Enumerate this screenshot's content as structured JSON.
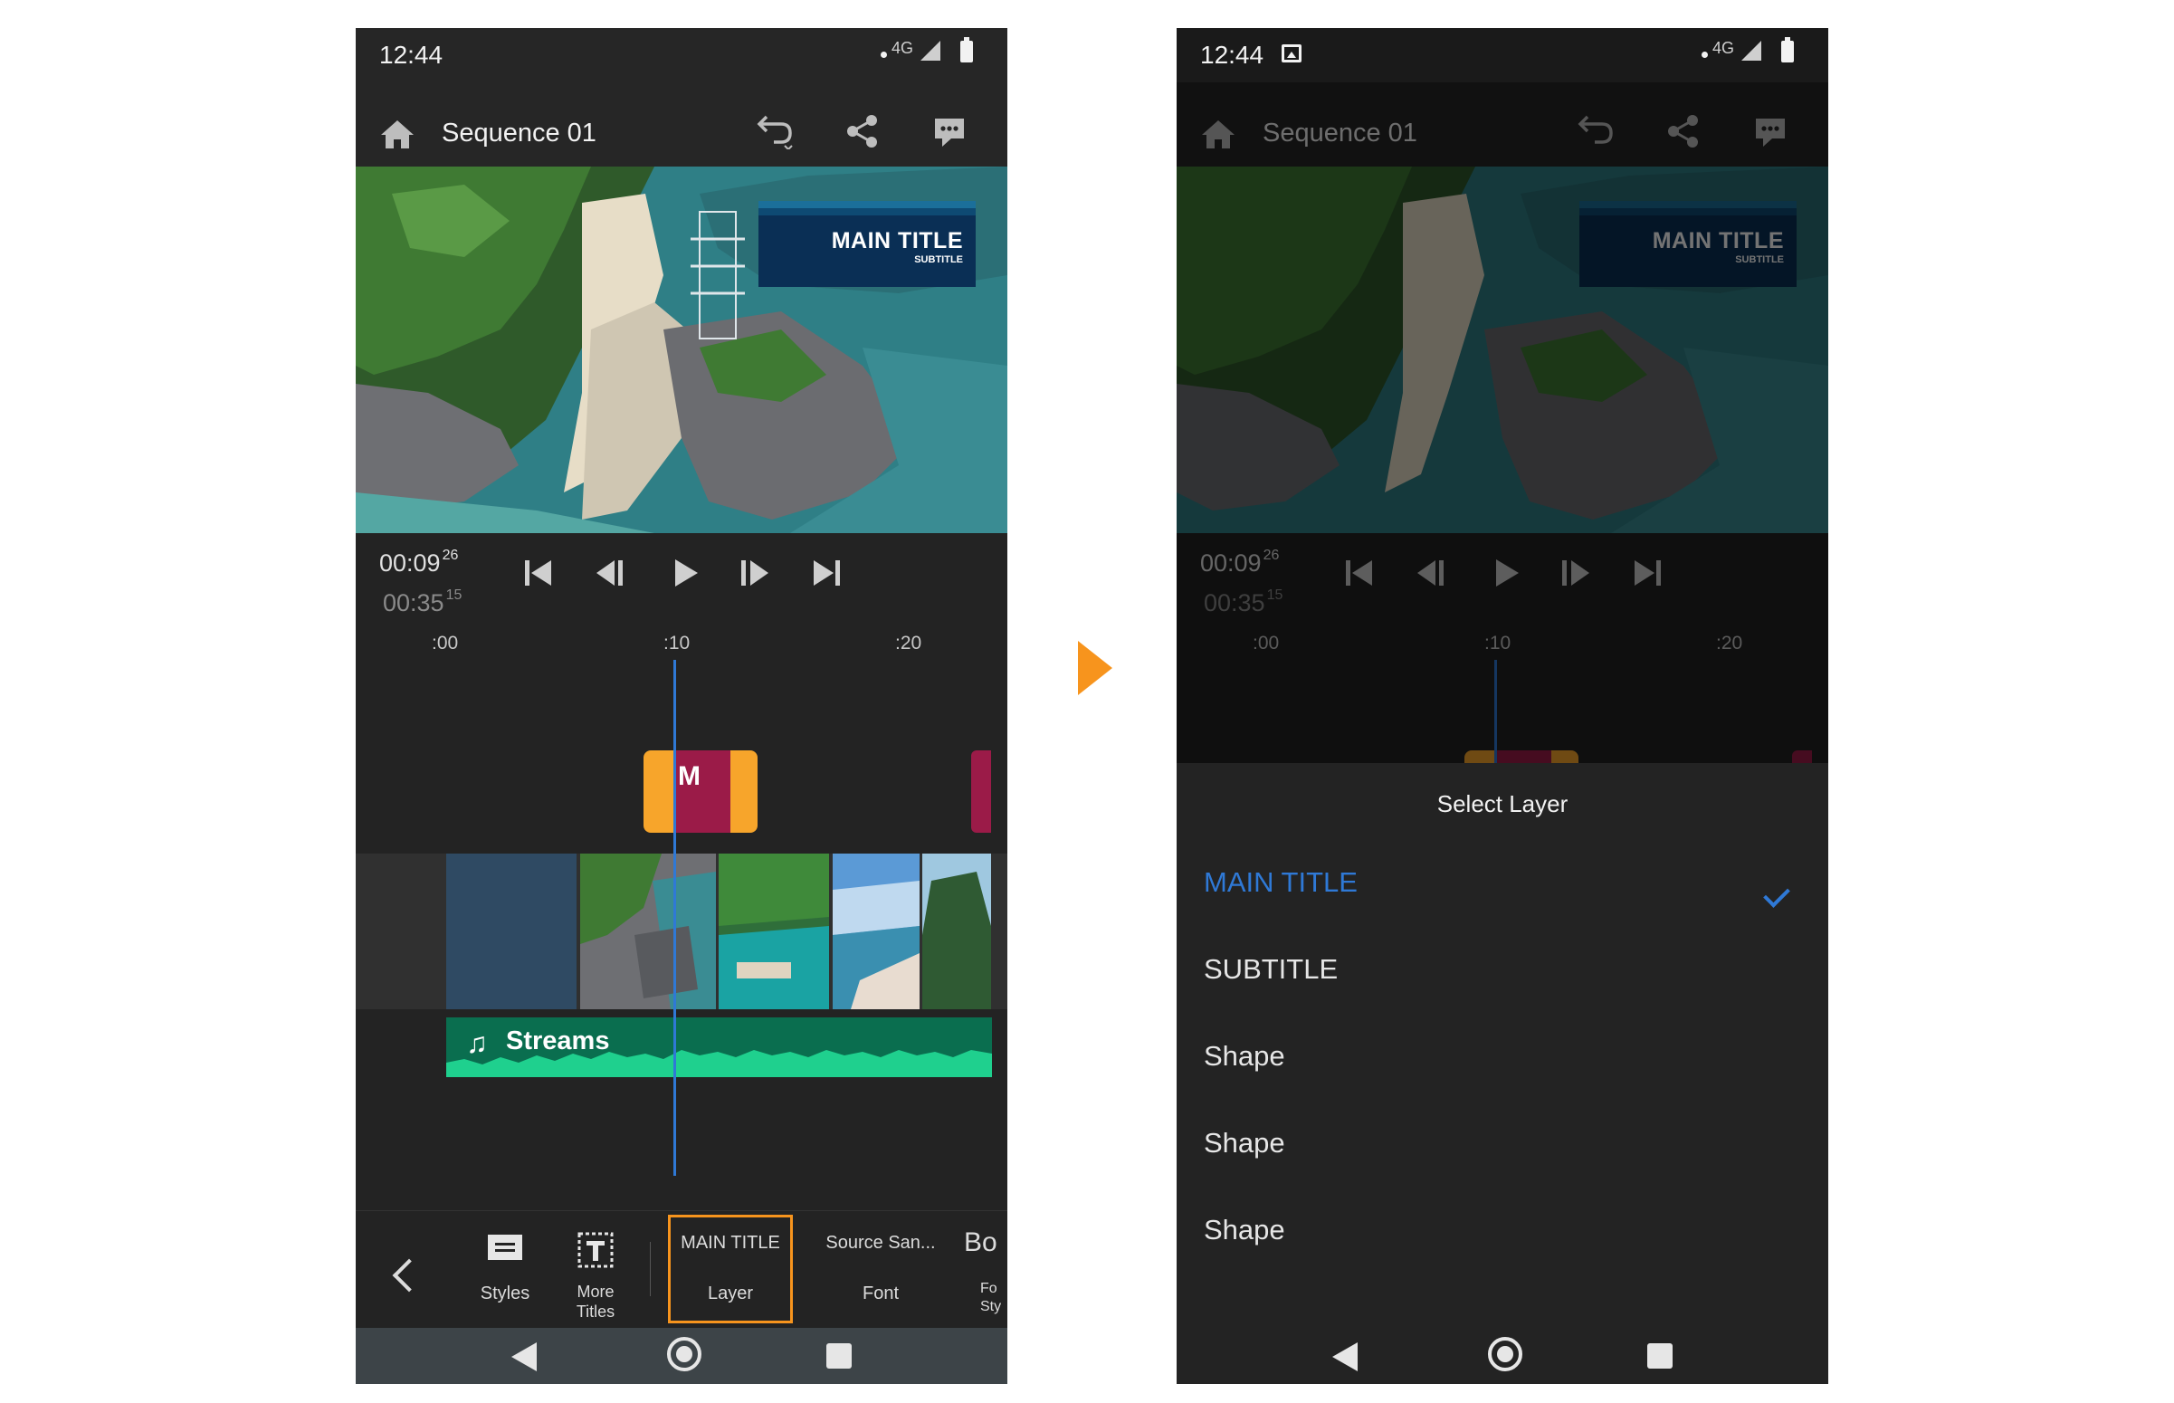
{
  "status": {
    "time": "12:44",
    "network": "4G"
  },
  "appbar": {
    "title": "Sequence 01"
  },
  "title_overlay": {
    "main": "MAIN TITLE",
    "sub": "SUBTITLE"
  },
  "transport": {
    "current": "00:09",
    "current_frames": "26",
    "total": "00:35",
    "total_frames": "15",
    "ruler": [
      ":00",
      ":10",
      ":20"
    ]
  },
  "timeline": {
    "title_clip_label": "M",
    "audio_label": "Streams"
  },
  "toolbar": {
    "items": [
      {
        "top": "",
        "label": "Styles"
      },
      {
        "top": "",
        "label": "More Titles"
      },
      {
        "top": "MAIN TITLE",
        "label": "Layer"
      },
      {
        "top": "Source San...",
        "label": "Font"
      },
      {
        "top": "Bo",
        "label": "Fo Sty"
      }
    ]
  },
  "layer_sheet": {
    "title": "Select Layer",
    "items": [
      "MAIN TITLE",
      "SUBTITLE",
      "Shape",
      "Shape",
      "Shape"
    ],
    "selected_index": 0
  },
  "colors": {
    "accent": "#f7941d",
    "selection_blue": "#2f79d6",
    "clip_magenta": "#9b1b48",
    "audio_green": "#0a6e4f"
  }
}
